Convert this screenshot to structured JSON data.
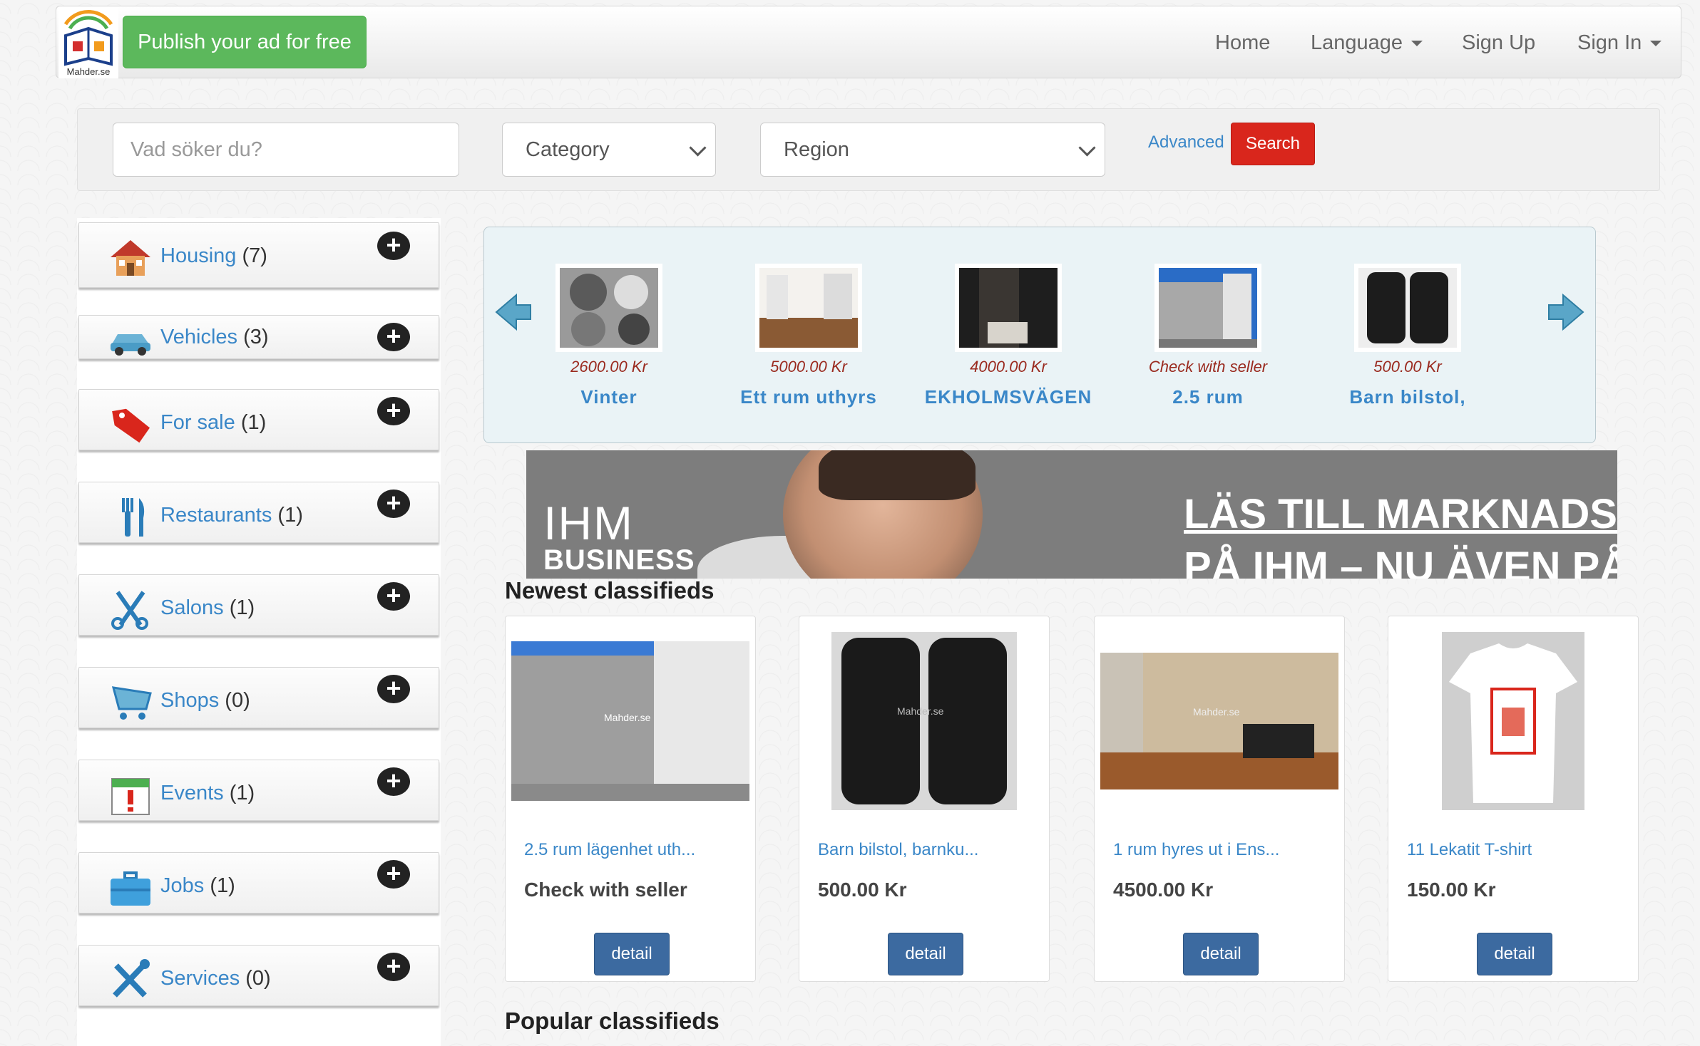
{
  "brand": {
    "name": "Mahder.se"
  },
  "navbar": {
    "publish_label": "Publish your ad for free",
    "home": "Home",
    "language": "Language",
    "signup": "Sign Up",
    "signin": "Sign In"
  },
  "search": {
    "placeholder": "Vad söker du?",
    "category": "Category",
    "region": "Region",
    "advanced": "Advanced",
    "button": "Search"
  },
  "sidebar": {
    "categories": [
      {
        "label": "Housing",
        "count": "(7)",
        "icon": "house-icon"
      },
      {
        "label": "Vehicles",
        "count": "(3)",
        "icon": "car-icon"
      },
      {
        "label": "For sale",
        "count": "(1)",
        "icon": "price-tag-icon"
      },
      {
        "label": "Restaurants",
        "count": "(1)",
        "icon": "fork-knife-icon"
      },
      {
        "label": "Salons",
        "count": "(1)",
        "icon": "scissors-icon"
      },
      {
        "label": "Shops",
        "count": "(0)",
        "icon": "shopping-cart-icon"
      },
      {
        "label": "Events",
        "count": "(1)",
        "icon": "calendar-icon"
      },
      {
        "label": "Jobs",
        "count": "(1)",
        "icon": "briefcase-icon"
      },
      {
        "label": "Services",
        "count": "(0)",
        "icon": "tools-icon"
      }
    ]
  },
  "carousel": {
    "items": [
      {
        "price": "2600.00 Kr",
        "title": "Vinter"
      },
      {
        "price": "5000.00 Kr",
        "title": "Ett rum uthyrs"
      },
      {
        "price": "4000.00 Kr",
        "title": "EKHOLMSVÄGEN"
      },
      {
        "price": "Check with seller",
        "title": "2.5 rum"
      },
      {
        "price": "500.00 Kr",
        "title": "Barn bilstol,"
      }
    ]
  },
  "banner": {
    "brand": "IHM",
    "brand_sub": "BUSINESS",
    "headline1": "LÄS TILL MARKNADSE",
    "headline2": "PÅ IHM – NU ÄVEN PÅ"
  },
  "newest": {
    "title": "Newest classifieds",
    "items": [
      {
        "title": "2.5 rum lägenhet uth...",
        "price": "Check with seller",
        "button": "detail",
        "watermark": "Mahder.se"
      },
      {
        "title": "Barn bilstol, barnku...",
        "price": "500.00 Kr",
        "button": "detail",
        "watermark": "Mahder.se"
      },
      {
        "title": "1 rum hyres ut i Ens...",
        "price": "4500.00 Kr",
        "button": "detail",
        "watermark": "Mahder.se"
      },
      {
        "title": "11 Lekatit T-shirt",
        "price": "150.00 Kr",
        "button": "detail"
      }
    ]
  },
  "popular": {
    "title": "Popular classifieds"
  },
  "colors": {
    "publish": "#5cb85c",
    "search_button": "#d9261c",
    "link": "#3a87c8",
    "detail_button": "#3c6aa0",
    "price": "#9a2a1f"
  }
}
